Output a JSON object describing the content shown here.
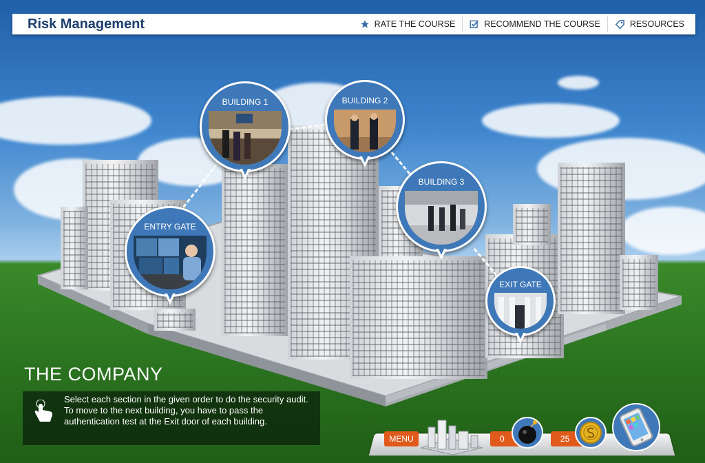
{
  "header": {
    "title": "Risk Management",
    "links": [
      {
        "label": "RATE THE COURSE",
        "icon": "star-icon"
      },
      {
        "label": "RECOMMEND THE COURSE",
        "icon": "checkbox-icon"
      },
      {
        "label": "RESOURCES",
        "icon": "tag-icon"
      }
    ]
  },
  "markers": [
    {
      "label": "ENTRY GATE"
    },
    {
      "label": "BUILDING 1"
    },
    {
      "label": "BUILDING 2"
    },
    {
      "label": "BUILDING 3"
    },
    {
      "label": "EXIT GATE"
    }
  ],
  "section": {
    "heading": "THE COMPANY",
    "instruction": "Select each section in the given order to do the security audit. To move to the next building, you have to pass the authentication test at the Exit door of each building."
  },
  "dock": {
    "menu_label": "MENU",
    "bombs": "0",
    "coins": "25"
  },
  "colors": {
    "accent": "#3f78b8",
    "title": "#1d3f6e",
    "dock_button": "#e05a1c"
  }
}
